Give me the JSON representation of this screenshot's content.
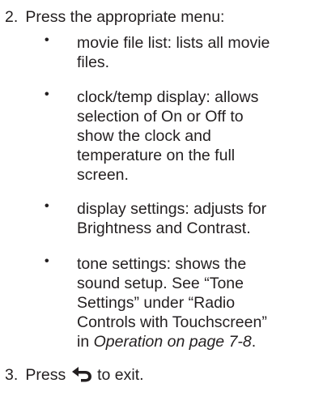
{
  "steps": [
    {
      "number": "2.",
      "text": "Press the appropriate menu:"
    },
    {
      "number": "3.",
      "text_before_icon": "Press",
      "icon": "back-arrow-icon",
      "text_after_icon": "to exit."
    }
  ],
  "bullets": [
    {
      "marker": "•",
      "lines": [
        "movie file list: lists all movie",
        "files."
      ]
    },
    {
      "marker": "•",
      "lines": [
        "clock/temp display: allows",
        "selection of On or Off to",
        "show the clock and",
        "temperature on the full",
        "screen."
      ]
    },
    {
      "marker": "•",
      "lines": [
        "display settings: adjusts for",
        "Brightness and Contrast."
      ]
    },
    {
      "marker": "•",
      "lines": [
        "tone settings: shows the",
        "sound setup. See “Tone",
        "Settings” under “Radio",
        "Controls with Touchscreen”"
      ],
      "last_line_prefix": "in ",
      "last_line_italic": "Operation on page 7-8",
      "last_line_suffix": "."
    }
  ]
}
